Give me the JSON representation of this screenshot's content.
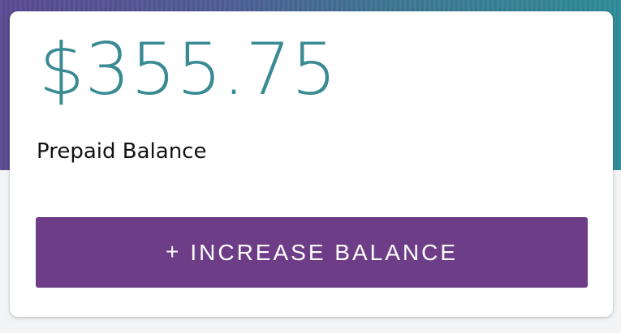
{
  "balance": {
    "amount": "$355.75",
    "label": "Prepaid Balance"
  },
  "actions": {
    "increase_icon": "+",
    "increase_label": "INCREASE BALANCE"
  },
  "colors": {
    "amount_text": "#3a8a93",
    "button_bg": "#6e3d87",
    "hero_gradient_start": "#5b4a92",
    "hero_gradient_end": "#2f8c98"
  },
  "icons": {
    "increase": "plus-icon"
  }
}
